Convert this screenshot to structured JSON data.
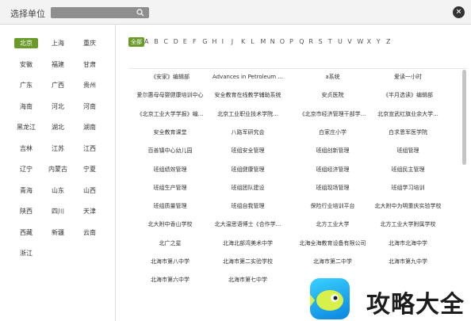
{
  "dialog": {
    "title": "选择单位",
    "search_placeholder": "",
    "close_label": "×"
  },
  "provinces": [
    {
      "label": "北京",
      "active": true
    },
    {
      "label": "上海",
      "active": false
    },
    {
      "label": "重庆",
      "active": false
    },
    {
      "label": "安徽",
      "active": false
    },
    {
      "label": "福建",
      "active": false
    },
    {
      "label": "甘肃",
      "active": false
    },
    {
      "label": "广东",
      "active": false
    },
    {
      "label": "广西",
      "active": false
    },
    {
      "label": "贵州",
      "active": false
    },
    {
      "label": "海南",
      "active": false
    },
    {
      "label": "河北",
      "active": false
    },
    {
      "label": "河南",
      "active": false
    },
    {
      "label": "黑龙江",
      "active": false
    },
    {
      "label": "湖北",
      "active": false
    },
    {
      "label": "湖南",
      "active": false
    },
    {
      "label": "吉林",
      "active": false
    },
    {
      "label": "江苏",
      "active": false
    },
    {
      "label": "江西",
      "active": false
    },
    {
      "label": "辽宁",
      "active": false
    },
    {
      "label": "内蒙古",
      "active": false
    },
    {
      "label": "宁夏",
      "active": false
    },
    {
      "label": "青海",
      "active": false
    },
    {
      "label": "山东",
      "active": false
    },
    {
      "label": "山西",
      "active": false
    },
    {
      "label": "陕西",
      "active": false
    },
    {
      "label": "四川",
      "active": false
    },
    {
      "label": "天津",
      "active": false
    },
    {
      "label": "西藏",
      "active": false
    },
    {
      "label": "新疆",
      "active": false
    },
    {
      "label": "云南",
      "active": false
    },
    {
      "label": "浙江",
      "active": false
    }
  ],
  "letters": [
    "全部",
    "A",
    "B",
    "C",
    "D",
    "E",
    "F",
    "G",
    "H",
    "I",
    "J",
    "K",
    "L",
    "M",
    "N",
    "O",
    "P",
    "Q",
    "R",
    "S",
    "T",
    "U",
    "V",
    "W",
    "X",
    "Y",
    "Z"
  ],
  "active_letter": "全部",
  "units": [
    [
      "《安家》编辑部",
      "Advances in Petroleum ...",
      "a系统",
      "爱读一小时"
    ],
    [
      "爱尔惠母母婴健康培训中心",
      "安全教育在线教学辅助系统",
      "安贞医院",
      "《半月选读》编辑部"
    ],
    [
      "《北京工业大学学报》编...",
      "北京工业职业技术学院...",
      "《北京市经济管理干部学...",
      "北京宣武红旗业余大学..."
    ],
    [
      "安全教育课堂",
      "八路军研究会",
      "白家庄小学",
      "白求恩军医学院"
    ],
    [
      "百善镇中心幼儿园",
      "班组安全管理",
      "班组创新管理",
      "班组管理"
    ],
    [
      "班组绩效管理",
      "班组健康管理",
      "班组经济管理",
      "班组民主管理"
    ],
    [
      "班组生产管理",
      "班组团队建设",
      "班组现场管理",
      "班组学习培训"
    ],
    [
      "班组质量管理",
      "班组自我管理",
      "保险行业培训平台",
      "北大附中为明重庆实验学校"
    ],
    [
      "北大附中香山学校",
      "北大温思语博士《合作学...",
      "北方工业大学",
      "北方工业大学附属学校"
    ],
    [
      "北广之星",
      "北海北部湾美术中学",
      "北海全海教育设备有限公司",
      "北海市北海中学"
    ],
    [
      "北海市第八中学",
      "北海市第二实验学校",
      "北海市第二中学",
      "北海市第九中学"
    ],
    [
      "北海市第六中学",
      "北海市第七中学",
      "",
      ""
    ]
  ],
  "watermark": {
    "text": "攻略大全"
  },
  "colors": {
    "accent": "#6a9a2a",
    "header_bg": "#f3f3f3"
  }
}
